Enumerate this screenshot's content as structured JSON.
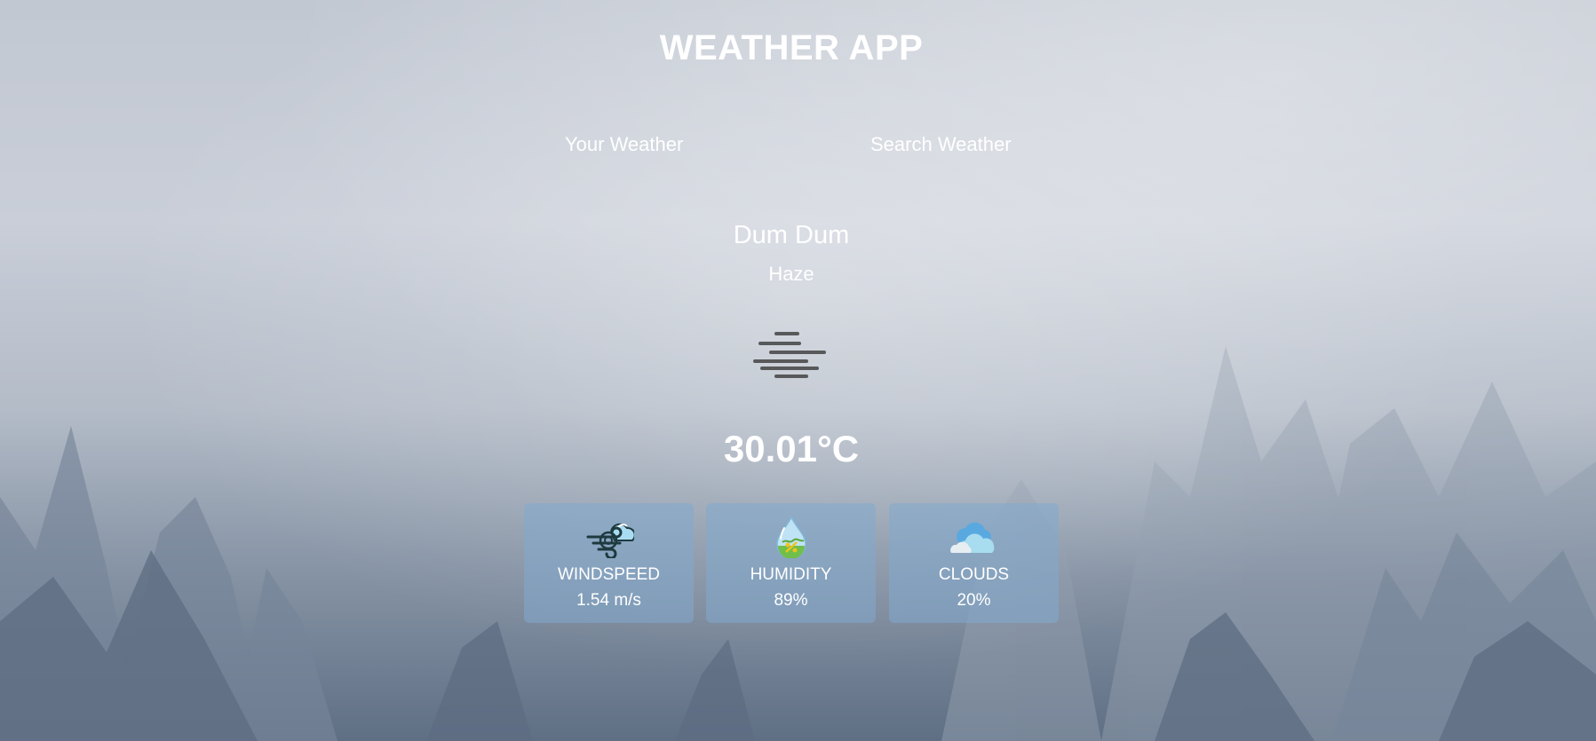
{
  "app": {
    "title": "WEATHER APP"
  },
  "tabs": [
    {
      "label": "Your Weather"
    },
    {
      "label": "Search Weather"
    }
  ],
  "location": {
    "city": "Dum Dum",
    "description": "Haze",
    "icon": "haze-icon"
  },
  "temperature": "30.01°C",
  "stats": [
    {
      "label": "WINDSPEED",
      "value": "1.54 m/s",
      "icon": "wind-icon"
    },
    {
      "label": "HUMIDITY",
      "value": "89%",
      "icon": "humidity-icon"
    },
    {
      "label": "CLOUDS",
      "value": "20%",
      "icon": "clouds-icon"
    }
  ],
  "colors": {
    "text": "#ffffff",
    "card_bg": "#82aacd",
    "icon_dark": "#444444"
  }
}
